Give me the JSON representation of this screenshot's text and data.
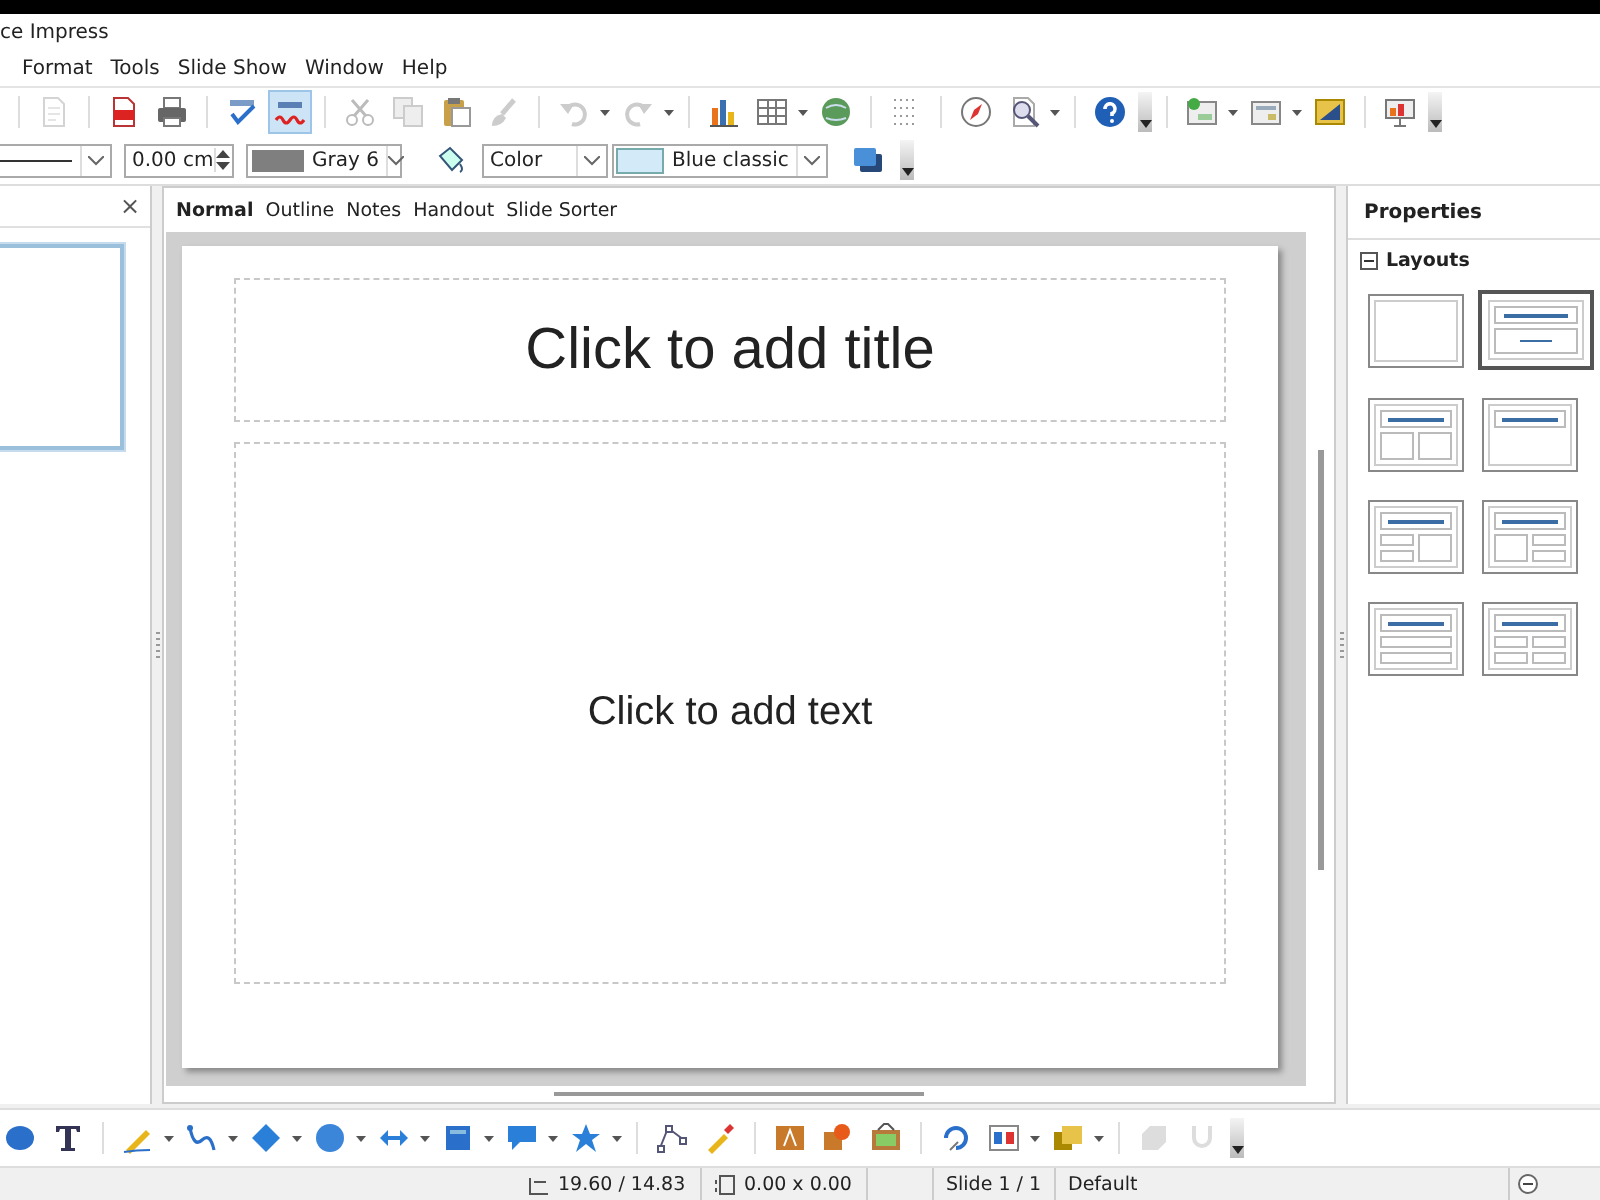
{
  "window": {
    "title": "ce Impress"
  },
  "menu": [
    "Format",
    "Tools",
    "Slide Show",
    "Window",
    "Help"
  ],
  "format_toolbar": {
    "line_width": "0.00 cm",
    "line_color": "Gray 6",
    "area_style": "Color",
    "area_fill": "Blue classic"
  },
  "slides_pane": {
    "close": "×",
    "slides": [
      {
        "selected": true
      }
    ]
  },
  "view_tabs": [
    {
      "label": "Normal",
      "selected": true
    },
    {
      "label": "Outline",
      "selected": false
    },
    {
      "label": "Notes",
      "selected": false
    },
    {
      "label": "Handout",
      "selected": false
    },
    {
      "label": "Slide Sorter",
      "selected": false
    }
  ],
  "slide": {
    "title_text": "Click to add title",
    "body_text": "Click to add text"
  },
  "properties": {
    "title": "Properties",
    "section": {
      "label": "Layouts",
      "expanded": true
    },
    "layouts": [
      {
        "kind": "blank",
        "selected": false
      },
      {
        "kind": "title-content",
        "selected": true
      },
      {
        "kind": "title-two-content",
        "selected": false
      },
      {
        "kind": "title-only",
        "selected": false
      },
      {
        "kind": "title-split-left",
        "selected": false
      },
      {
        "kind": "title-split-right",
        "selected": false
      },
      {
        "kind": "title-two-rows",
        "selected": false
      },
      {
        "kind": "title-four-content",
        "selected": false
      }
    ]
  },
  "status_bar": {
    "position": "19.60 / 14.83",
    "size": "0.00 x 0.00",
    "slide": "Slide 1 / 1",
    "master": "Default"
  }
}
